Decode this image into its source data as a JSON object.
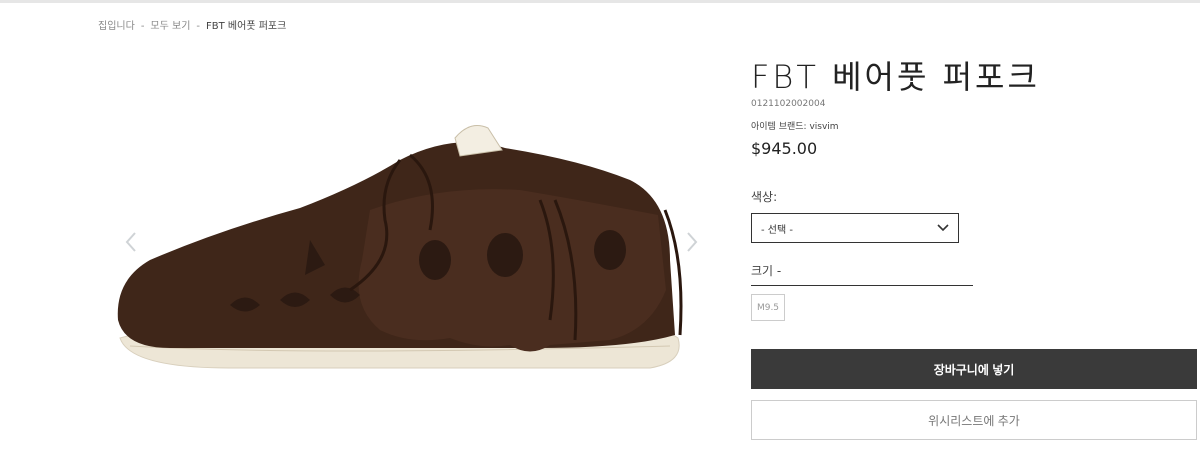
{
  "breadcrumb": {
    "home": "집입니다",
    "all": "모두 보기",
    "current": "FBT 베어풋 퍼포크",
    "separator": "-"
  },
  "product": {
    "title": "FBT 베어풋 퍼포크",
    "sku": "0121102002004",
    "brand_label": "아이템 브랜드:",
    "brand_value": "visvim",
    "price": "$945.00"
  },
  "options": {
    "color_label": "색상:",
    "color_selected": "- 선택 -",
    "size_label": "크기 -",
    "sizes": [
      "M9.5"
    ]
  },
  "actions": {
    "add_to_cart": "장바구니에 넣기",
    "add_to_wishlist": "위시리스트에 추가"
  },
  "gallery": {
    "prev_icon": "chevron-left-icon",
    "next_icon": "chevron-right-icon"
  },
  "colors": {
    "primary_button": "#3a3a3a",
    "arrow": "#cfd3d6",
    "shoe": "#3f2619",
    "sole": "#ede6d6"
  }
}
